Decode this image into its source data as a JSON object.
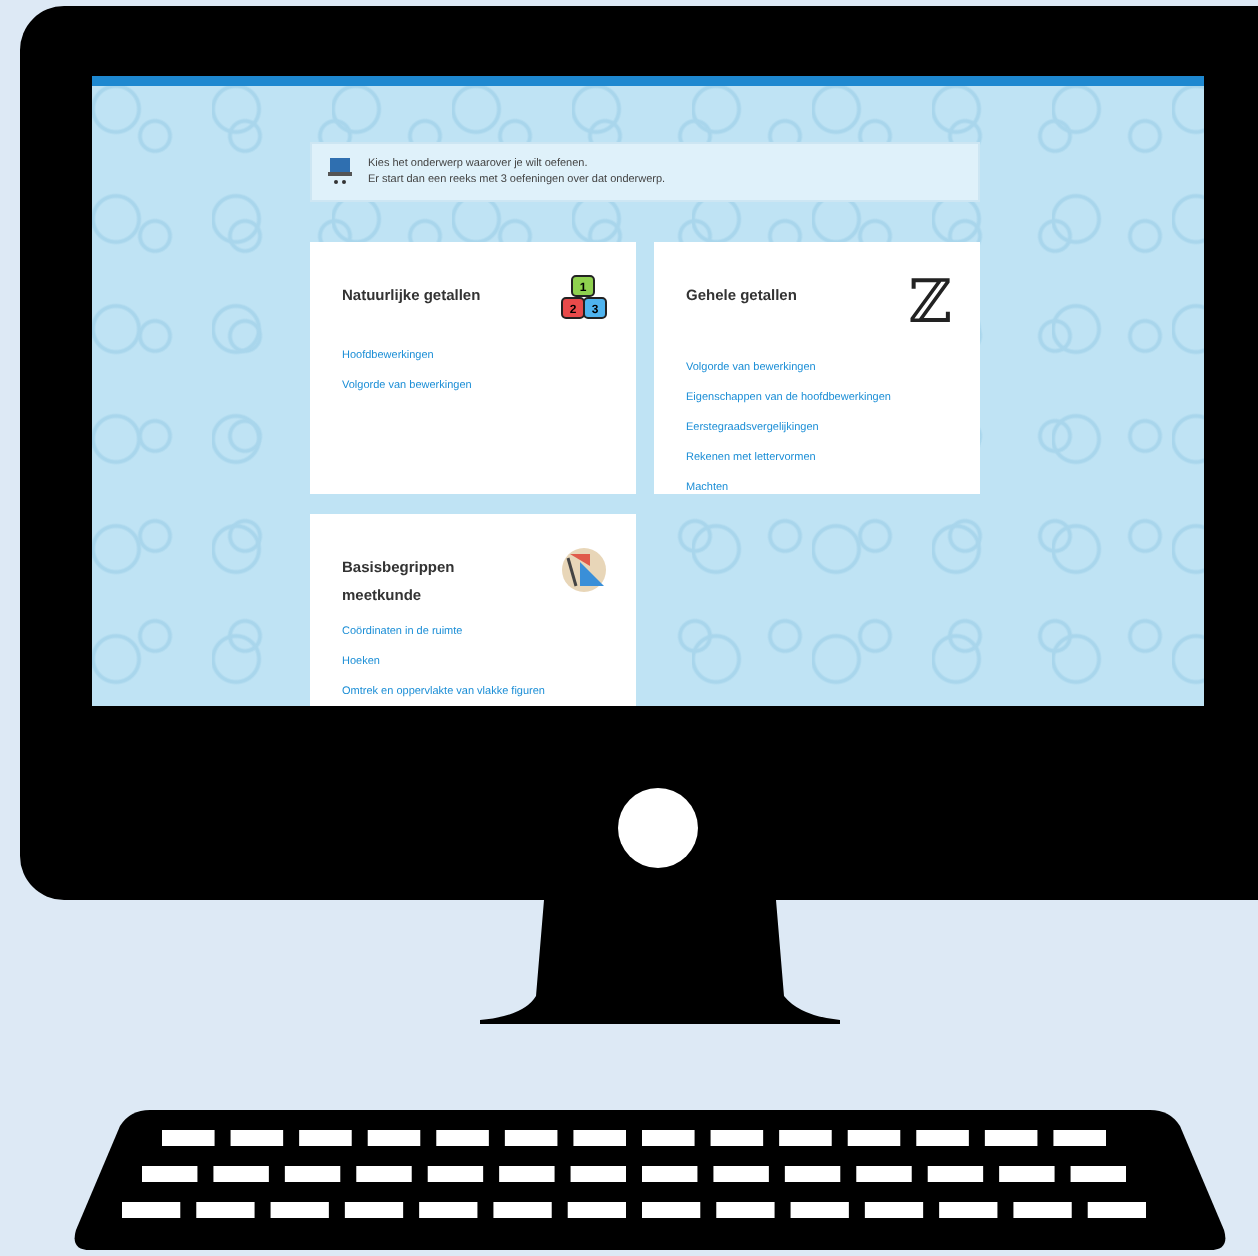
{
  "notice": {
    "lines": [
      "Kies het onderwerp waarover je wilt oefenen.",
      "Er start dan een reeks met 3 oefeningen over dat onderwerp."
    ]
  },
  "cards": [
    {
      "title": "Natuurlijke getallen",
      "kind": "blocks",
      "digits": [
        "1",
        "2",
        "3"
      ],
      "links": [
        "Hoofdbewerkingen",
        "Volgorde van bewerkingen"
      ]
    },
    {
      "title": "Gehele getallen",
      "kind": "symbol",
      "symbol": "ℤ",
      "links": [
        "Volgorde van bewerkingen",
        "Eigenschappen van de hoofdbewerkingen",
        "Eerstegraadsvergelijkingen",
        "Rekenen met lettervormen",
        "Machten"
      ]
    },
    {
      "title": "Basisbegrippen meetkunde",
      "kind": "geometry",
      "links": [
        "Coördinaten in de ruimte",
        "Hoeken",
        "Omtrek en oppervlakte van vlakke figuren"
      ]
    }
  ]
}
